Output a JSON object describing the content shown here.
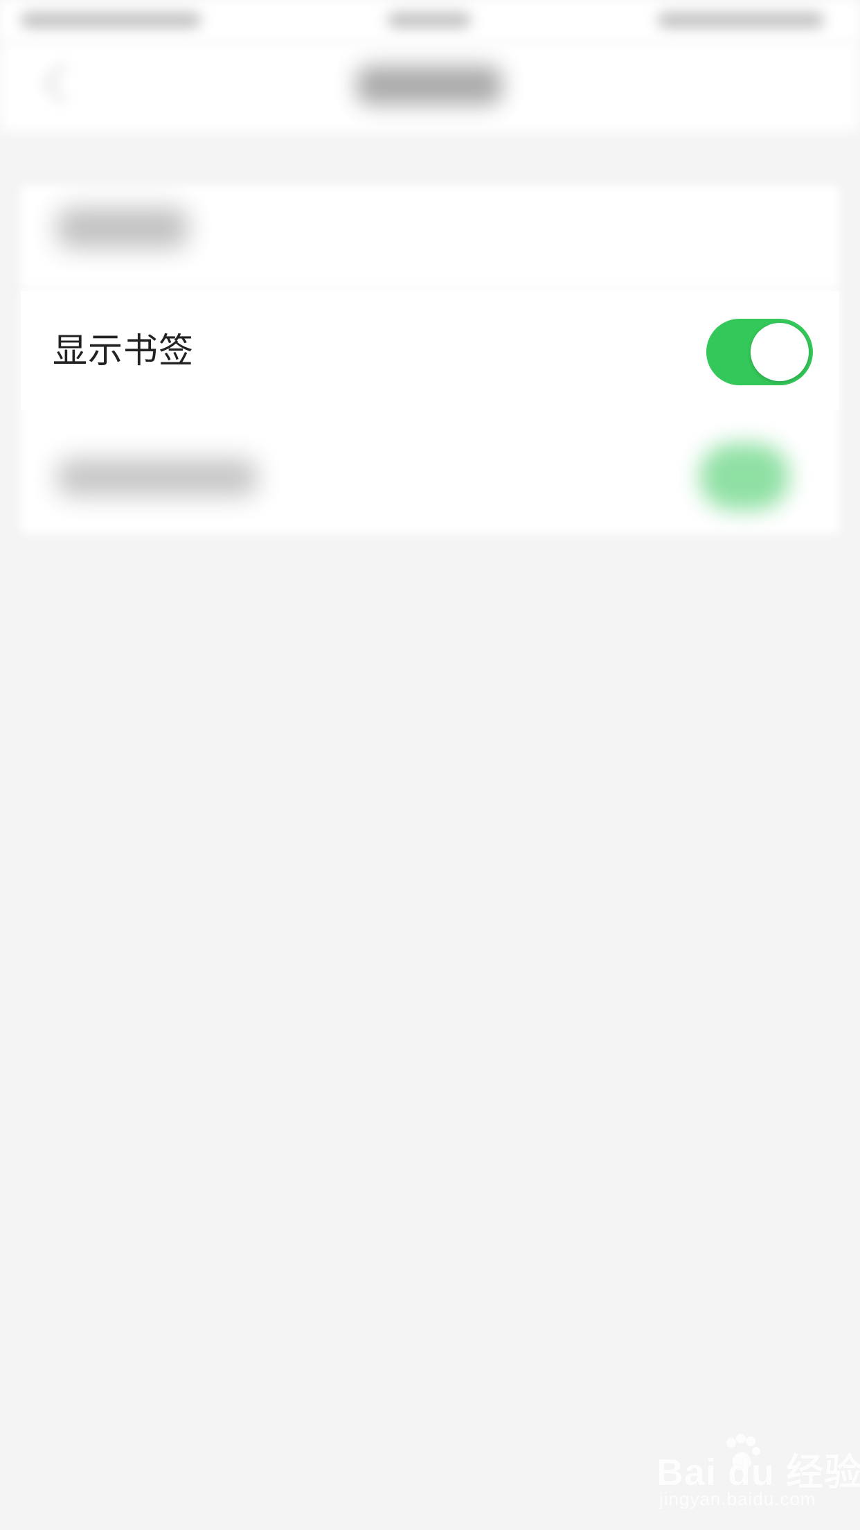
{
  "settings": {
    "rows": [
      {
        "label": "显示书签",
        "toggle_on": true
      }
    ]
  },
  "watermark": {
    "brand": "Bai du 经验",
    "url": "jingyan.baidu.com"
  },
  "colors": {
    "background": "#f4f4f4",
    "card": "#ffffff",
    "toggle_on": "#34C759",
    "text": "#222222"
  }
}
